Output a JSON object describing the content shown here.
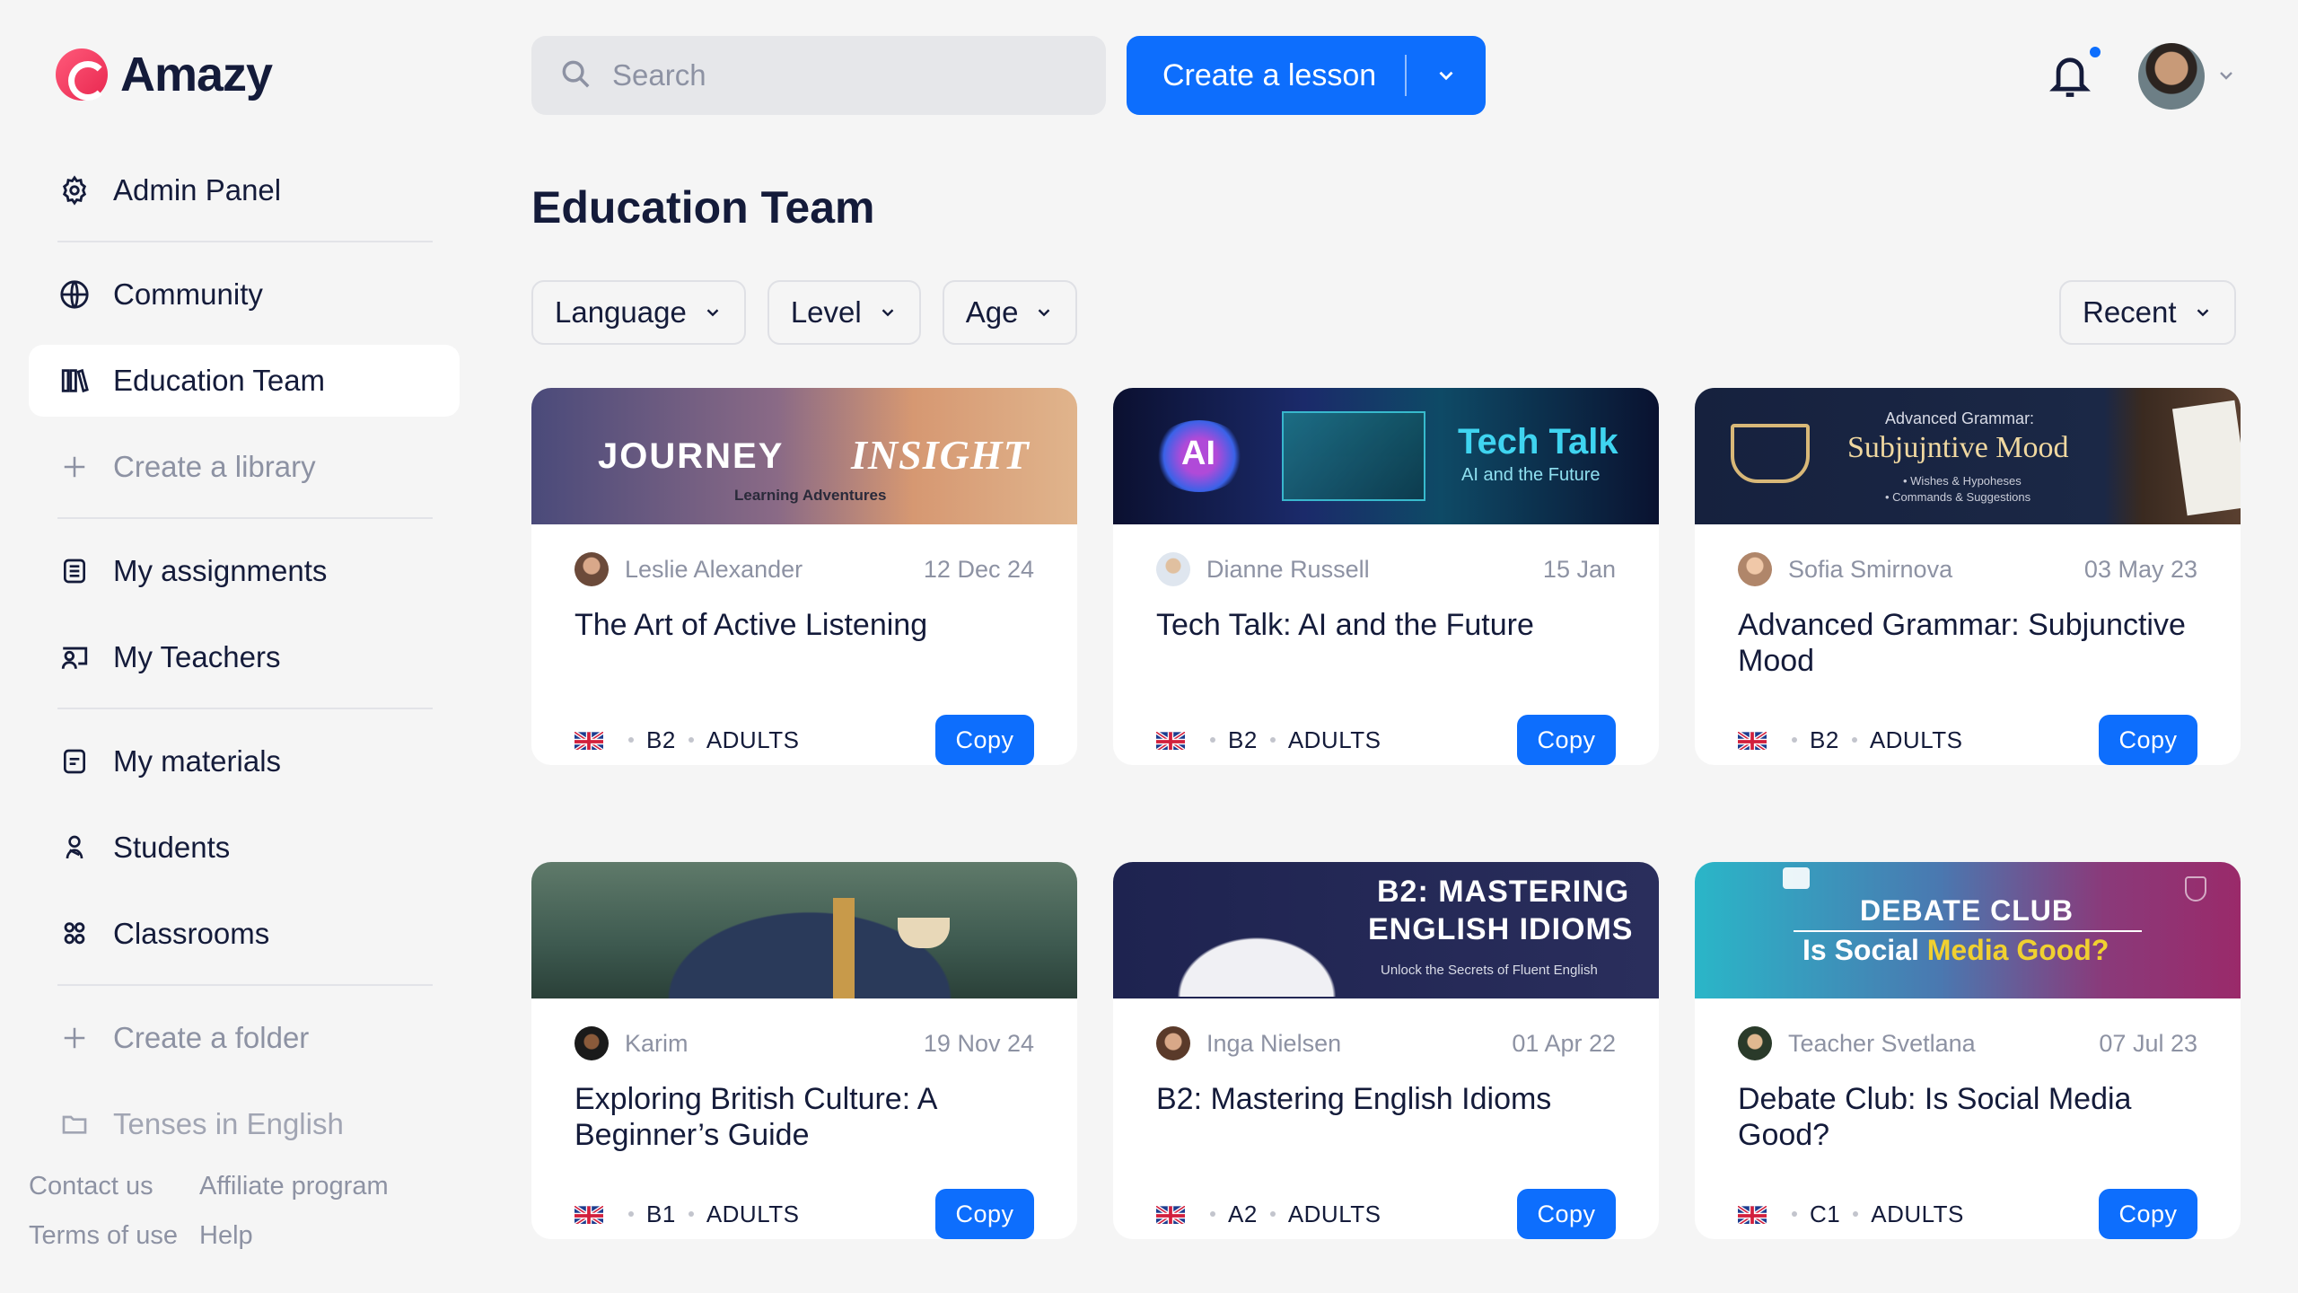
{
  "app": {
    "name": "Amazy",
    "brand_color": "#e8274f",
    "accent": "#0d6efd"
  },
  "sidebar": {
    "items": [
      {
        "label": "Admin Panel",
        "icon": "gear-icon"
      },
      {
        "label": "Community",
        "icon": "globe-icon"
      },
      {
        "label": "Education Team",
        "icon": "library-icon",
        "active": true
      },
      {
        "label": "Create a library",
        "icon": "plus-icon"
      },
      {
        "label": "My assignments",
        "icon": "assignments-icon"
      },
      {
        "label": "My Teachers",
        "icon": "teacher-icon"
      },
      {
        "label": "My materials",
        "icon": "document-icon"
      },
      {
        "label": "Students",
        "icon": "students-icon"
      },
      {
        "label": "Classrooms",
        "icon": "classrooms-icon"
      },
      {
        "label": "Create a folder",
        "icon": "plus-icon"
      },
      {
        "label": "Tenses in English",
        "icon": "folder-icon"
      }
    ],
    "footer": [
      "Contact us",
      "Affiliate program",
      "Terms of use",
      "Help"
    ]
  },
  "header": {
    "search_placeholder": "Search",
    "create_label": "Create a lesson"
  },
  "page": {
    "title": "Education Team"
  },
  "filters": [
    "Language",
    "Level",
    "Age"
  ],
  "sort": "Recent",
  "cards": [
    {
      "author": "Leslie Alexander",
      "date": "12 Dec 24",
      "title": "The Art of Active Listening",
      "level": "B2",
      "age": "ADULTS",
      "copy": "Copy",
      "banner": {
        "line1": "JOURNEY",
        "line2": "INSIGHT",
        "line3": "Learning Adventures"
      }
    },
    {
      "author": "Dianne Russell",
      "date": "15 Jan",
      "title": "Tech Talk: AI and the Future",
      "level": "B2",
      "age": "ADULTS",
      "copy": "Copy",
      "banner": {
        "line1": "AI",
        "line2": "Tech Talk",
        "line3": "AI and the Future"
      }
    },
    {
      "author": "Sofia Smirnova",
      "date": "03 May 23",
      "title": "Advanced Grammar: Subjunctive Mood",
      "level": "B2",
      "age": "ADULTS",
      "copy": "Copy",
      "banner": {
        "line1": "Advanced Grammar:",
        "line2": "Subjujntive Mood",
        "line3": "• Wishes & Hypoheses",
        "line4": "• Commands & Suggestions"
      }
    },
    {
      "author": "Karim",
      "date": "19 Nov 24",
      "title": "Exploring British Culture: A Beginner’s Guide",
      "level": "B1",
      "age": "ADULTS",
      "copy": "Copy",
      "banner": {}
    },
    {
      "author": "Inga Nielsen",
      "date": "01 Apr 22",
      "title": "B2: Mastering English Idioms",
      "level": "A2",
      "age": "ADULTS",
      "copy": "Copy",
      "banner": {
        "line1": "B2: MASTERING",
        "line2": "ENGLISH IDIOMS",
        "line3": "Unlock the Secrets of Fluent English"
      }
    },
    {
      "author": "Teacher Svetlana",
      "date": "07 Jul 23",
      "title": "Debate Club: Is Social Media Good?",
      "level": "C1",
      "age": "ADULTS",
      "copy": "Copy",
      "banner": {
        "line1": "DEBATE CLUB",
        "line2a": "Is Social ",
        "line2b": "Media Good?"
      }
    }
  ]
}
